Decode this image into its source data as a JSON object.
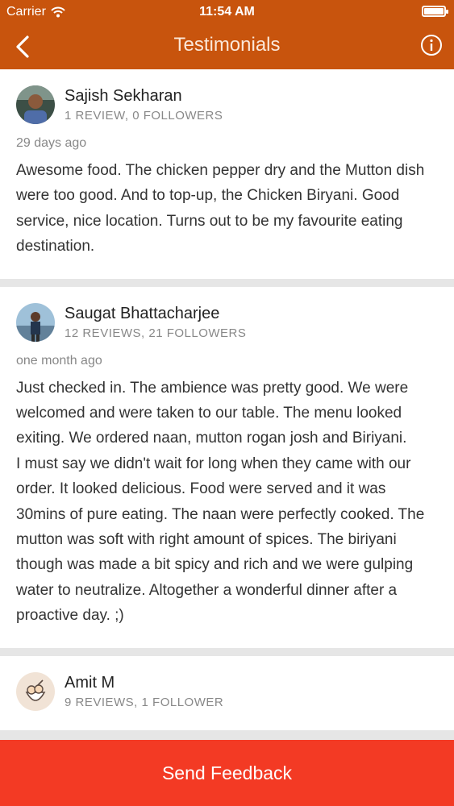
{
  "status_bar": {
    "carrier": "Carrier",
    "time": "11:54 AM"
  },
  "header": {
    "title": "Testimonials"
  },
  "reviews": [
    {
      "name": "Sajish Sekharan",
      "stats": "1 REVIEW, 0 FOLLOWERS",
      "date": "29 days ago",
      "text": "Awesome food. The chicken pepper dry and the Mutton dish were too good. And to top-up, the Chicken Biryani. Good service, nice location. Turns out to be my favourite eating destination."
    },
    {
      "name": "Saugat Bhattacharjee",
      "stats": "12 REVIEWS, 21 FOLLOWERS",
      "date": "one month ago",
      "text": "Just checked in. The ambience was pretty good. We were welcomed and were taken to our table. The menu looked exiting. We ordered naan, mutton rogan josh and Biriyani.\nI must say we didn't wait for long when they came with our order. It looked delicious. Food were served and it was 30mins of pure eating. The naan were perfectly cooked. The mutton was soft with right amount of spices. The biriyani though was made a bit spicy and rich and we were gulping water to neutralize. Altogether a wonderful dinner after a proactive day. ;)"
    },
    {
      "name": "Amit M",
      "stats": "9 REVIEWS, 1 FOLLOWER",
      "date": "",
      "text": ""
    }
  ],
  "footer": {
    "button_label": "Send Feedback"
  },
  "colors": {
    "header": "#c8540d",
    "button": "#f33a24"
  }
}
